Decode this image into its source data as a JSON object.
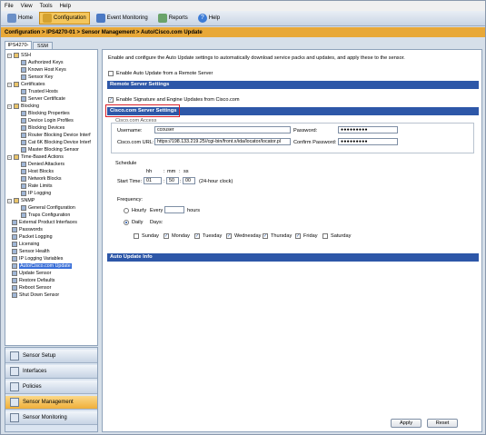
{
  "menu": [
    "File",
    "View",
    "Tools",
    "Help"
  ],
  "toolbar": {
    "home": "Home",
    "configuration": "Configuration",
    "event_monitoring": "Event Monitoring",
    "reports": "Reports",
    "help": "Help"
  },
  "breadcrumb": "Configuration > IPS4270-01 > Sensor Management > Auto/Cisco.com Update",
  "sensor_tabs": [
    "IPS4270-01",
    "SSM"
  ],
  "tree": [
    {
      "label": "SSH",
      "level": 0,
      "expander": "−"
    },
    {
      "label": "Authorized Keys",
      "level": 2
    },
    {
      "label": "Known Host Keys",
      "level": 2
    },
    {
      "label": "Sensor Key",
      "level": 2
    },
    {
      "label": "Certificates",
      "level": 0,
      "expander": "−"
    },
    {
      "label": "Trusted Hosts",
      "level": 2
    },
    {
      "label": "Server Certificate",
      "level": 2
    },
    {
      "label": "Blocking",
      "level": 0,
      "expander": "−"
    },
    {
      "label": "Blocking Properties",
      "level": 2
    },
    {
      "label": "Device Login Profiles",
      "level": 2
    },
    {
      "label": "Blocking Devices",
      "level": 2
    },
    {
      "label": "Router Blocking Device Interf",
      "level": 2
    },
    {
      "label": "Cat 6K Blocking Device Interf",
      "level": 2
    },
    {
      "label": "Master Blocking Sensor",
      "level": 2
    },
    {
      "label": "Time-Based Actions",
      "level": 0,
      "expander": "−"
    },
    {
      "label": "Denied Attackers",
      "level": 2
    },
    {
      "label": "Host Blocks",
      "level": 2
    },
    {
      "label": "Network Blocks",
      "level": 2
    },
    {
      "label": "Rate Limits",
      "level": 2
    },
    {
      "label": "IP Logging",
      "level": 2
    },
    {
      "label": "SNMP",
      "level": 0,
      "expander": "−"
    },
    {
      "label": "General Configuration",
      "level": 2
    },
    {
      "label": "Traps Configuration",
      "level": 2
    },
    {
      "label": "External Product Interfaces",
      "level": 1
    },
    {
      "label": "Passwords",
      "level": 1
    },
    {
      "label": "Packet Logging",
      "level": 1
    },
    {
      "label": "Licensing",
      "level": 1
    },
    {
      "label": "Sensor Health",
      "level": 1
    },
    {
      "label": "IP Logging Variables",
      "level": 1
    },
    {
      "label": "Auto/Cisco.com Update",
      "level": 1,
      "selected": true
    },
    {
      "label": "Update Sensor",
      "level": 1
    },
    {
      "label": "Restore Defaults",
      "level": 1
    },
    {
      "label": "Reboot Sensor",
      "level": 1
    },
    {
      "label": "Shut Down Sensor",
      "level": 1
    }
  ],
  "nav_buttons": [
    {
      "label": "Sensor Setup"
    },
    {
      "label": "Interfaces"
    },
    {
      "label": "Policies"
    },
    {
      "label": "Sensor Management",
      "active": true
    },
    {
      "label": "Sensor Monitoring"
    }
  ],
  "main": {
    "intro": "Enable and configure the Auto Update settings to automatically download service packs and updates, and apply these to the sensor.",
    "enable_remote_label": "Enable Auto Update from a Remote Server",
    "remote_section": "Remote Server Settings",
    "enable_sig_label": "Enable Signature and Engine Updates from Cisco.com",
    "cisco_section": "Cisco.com Server Settings",
    "cisco_access_label": "Cisco.com Access",
    "username_label": "Username:",
    "username_value": "ccouser",
    "password_label": "Password:",
    "password_value": "●●●●●●●●●",
    "url_label": "Cisco.com URL:",
    "url_value": "https://198.133.219.25//cgi-bin/front.x/ida/locator/locator.pl",
    "confirm_label": "Confirm Password:",
    "confirm_value": "●●●●●●●●●",
    "schedule_label": "Schedule",
    "hh": "hh",
    "mm": "mm",
    "ss": "ss",
    "start_time_label": "Start Time:",
    "start_hh": "01",
    "start_mm": "50",
    "start_ss": "00",
    "clock_note": "(24-hour clock)",
    "frequency_label": "Frequency:",
    "hourly_label": "Hourly",
    "every_label": "Every",
    "hours_label": "hours",
    "daily_label": "Daily",
    "days_label": "Days:",
    "days": [
      {
        "name": "Sunday",
        "checked": false
      },
      {
        "name": "Monday",
        "checked": true
      },
      {
        "name": "Tuesday",
        "checked": true
      },
      {
        "name": "Wednesday",
        "checked": true
      },
      {
        "name": "Thursday",
        "checked": true
      },
      {
        "name": "Friday",
        "checked": true
      },
      {
        "name": "Saturday",
        "checked": false
      }
    ],
    "autoinfo_section": "Auto Update Info",
    "apply": "Apply",
    "reset": "Reset"
  },
  "colors": {
    "section_bar": "#2d57a8",
    "highlight": "#d91f2a",
    "active_nav": "#efae3a"
  }
}
